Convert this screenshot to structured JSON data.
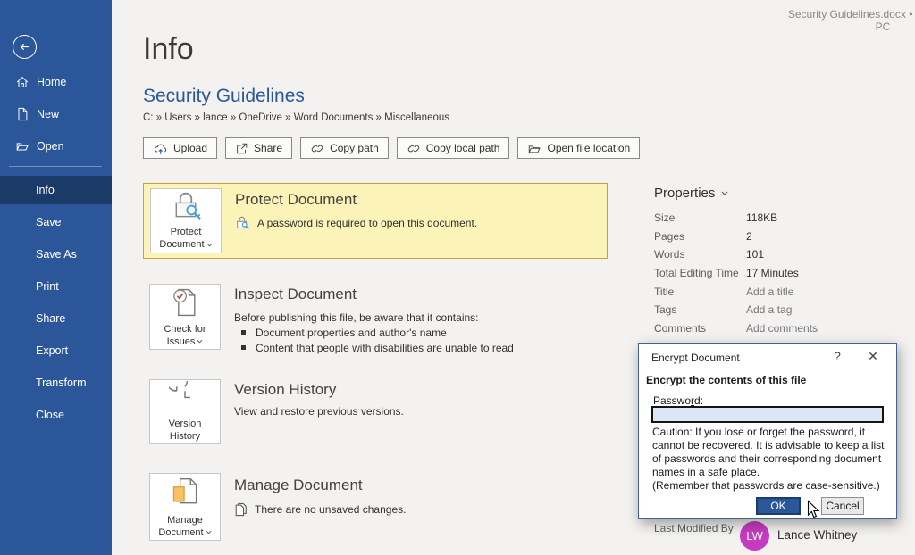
{
  "window": {
    "status_text": "Security Guidelines.docx • Saved to this PC"
  },
  "sidebar": {
    "top_items": [
      {
        "label": "Home",
        "icon": "home-icon"
      },
      {
        "label": "New",
        "icon": "new-document-icon"
      },
      {
        "label": "Open",
        "icon": "open-folder-icon"
      }
    ],
    "menu_items": [
      {
        "label": "Info",
        "selected": true
      },
      {
        "label": "Save"
      },
      {
        "label": "Save As"
      },
      {
        "label": "Print"
      },
      {
        "label": "Share"
      },
      {
        "label": "Export"
      },
      {
        "label": "Transform"
      },
      {
        "label": "Close"
      }
    ]
  },
  "info_page": {
    "title": "Info",
    "doc_title": "Security Guidelines",
    "doc_path": "C: » Users » lance » OneDrive » Word Documents » Miscellaneous",
    "toolbar": [
      {
        "label": "Upload",
        "icon": "cloud-upload-icon"
      },
      {
        "label": "Share",
        "icon": "share-icon"
      },
      {
        "label": "Copy path",
        "icon": "link-icon"
      },
      {
        "label": "Copy local path",
        "icon": "link-icon"
      },
      {
        "label": "Open file location",
        "icon": "folder-icon"
      }
    ],
    "sections": [
      {
        "tile_label": "Protect Document",
        "title": "Protect Document",
        "desc": "A password is required to open this document.",
        "highlighted": true
      },
      {
        "tile_label": "Check for Issues",
        "title": "Inspect Document",
        "intro": "Before publishing this file, be aware that it contains:",
        "bullets": [
          "Document properties and author's name",
          "Content that people with disabilities are unable to read"
        ]
      },
      {
        "tile_label": "Version History",
        "title": "Version History",
        "desc": "View and restore previous versions."
      },
      {
        "tile_label": "Manage Document",
        "title": "Manage Document",
        "desc": "There are no unsaved changes."
      }
    ]
  },
  "properties": {
    "header": "Properties",
    "rows": [
      {
        "label": "Size",
        "value": "118KB"
      },
      {
        "label": "Pages",
        "value": "2"
      },
      {
        "label": "Words",
        "value": "101"
      },
      {
        "label": "Total Editing Time",
        "value": "17 Minutes"
      },
      {
        "label": "Title",
        "value": "Add a title"
      },
      {
        "label": "Tags",
        "value": "Add a tag"
      },
      {
        "label": "Comments",
        "value": "Add comments"
      }
    ],
    "last_modified_label": "Last Modified By",
    "person": {
      "initials": "LW",
      "name": "Lance Whitney",
      "avatar_color": "#c63bc0"
    }
  },
  "dialog": {
    "title": "Encrypt Document",
    "heading": "Encrypt the contents of this file",
    "password_label_pre": "Passwo",
    "password_label_accel": "r",
    "password_label_post": "d:",
    "password_value": "",
    "caution": "Caution: If you lose or forget the password, it cannot be recovered. It is advisable to keep a list of passwords and their corresponding document names in a safe place.",
    "note": "(Remember that passwords are case-sensitive.)",
    "ok_label": "OK",
    "cancel_label": "Cancel"
  },
  "colors": {
    "accent": "#2b579a",
    "sidebar_selected": "#1a3a67",
    "highlight_bg": "#fbf3b8",
    "highlight_border": "#c2a33b",
    "avatar": "#c63bc0"
  }
}
